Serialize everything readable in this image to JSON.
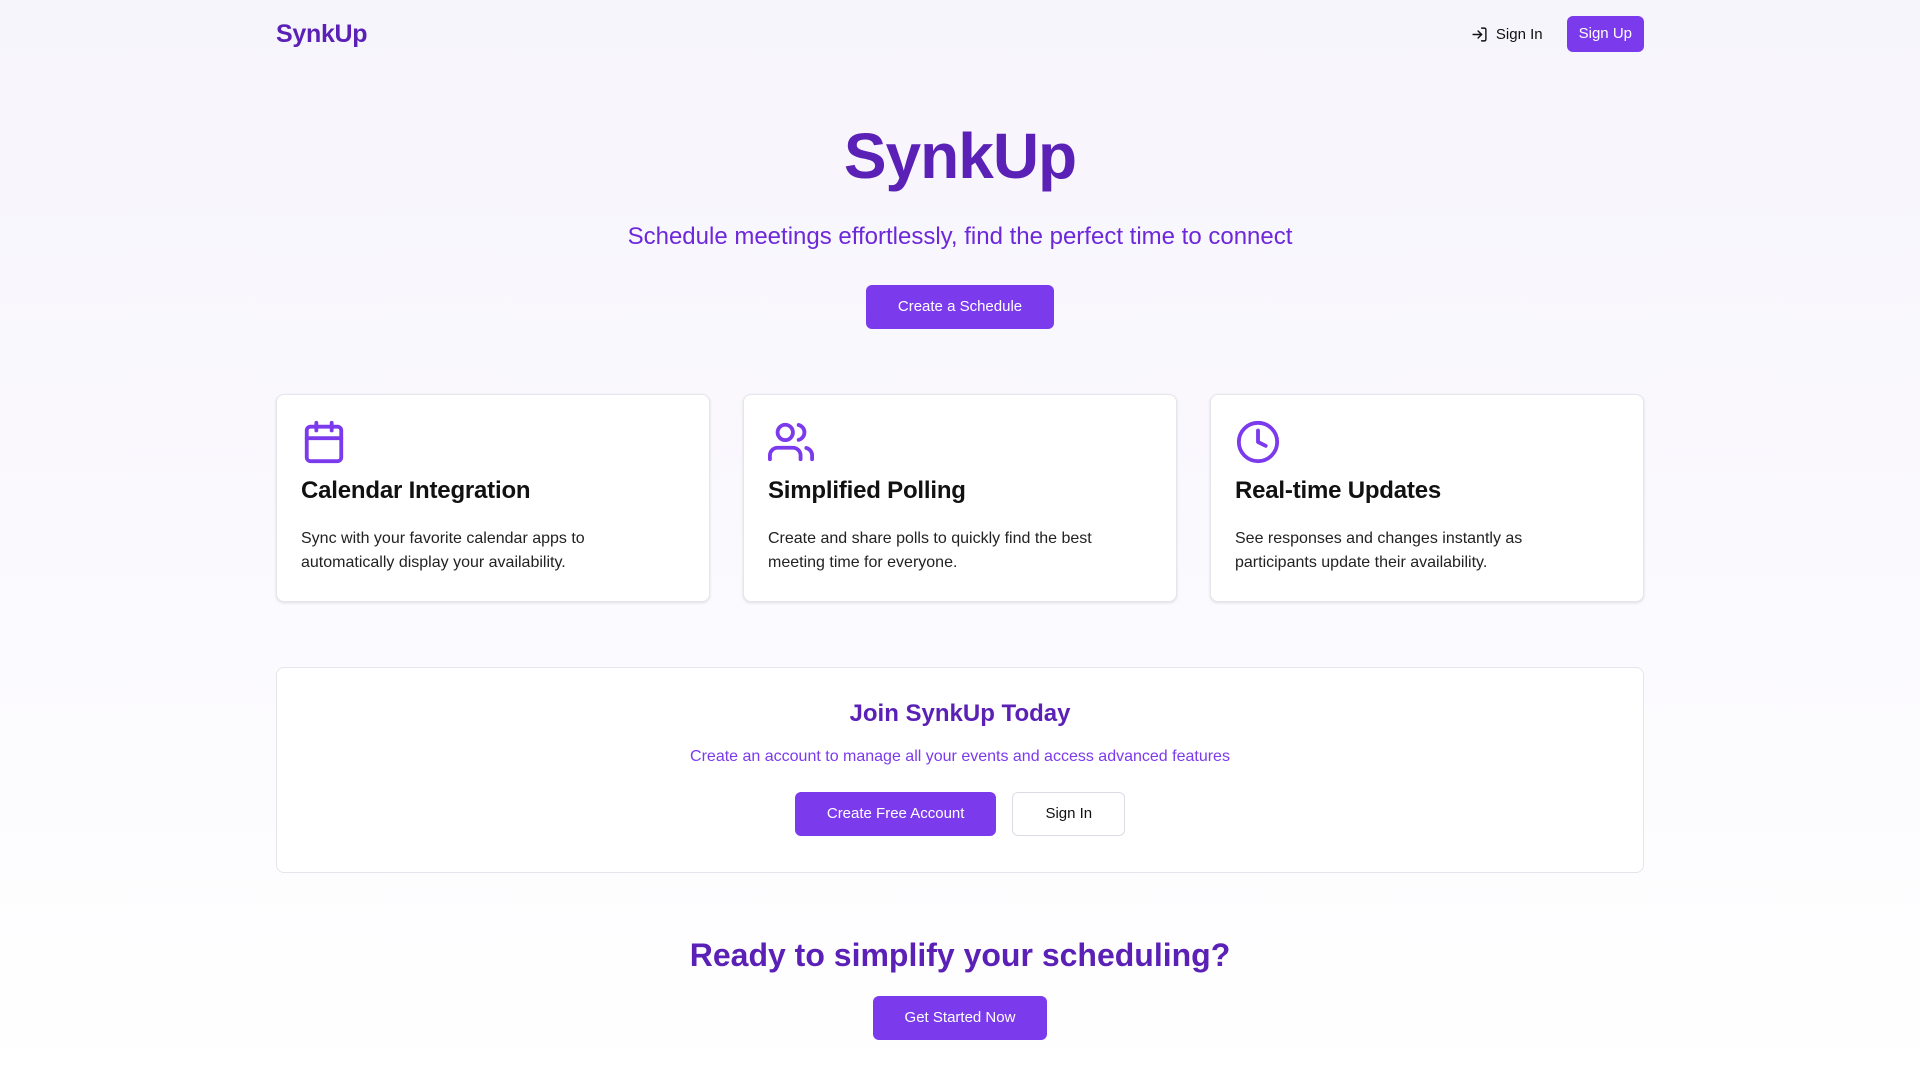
{
  "header": {
    "brand": "SynkUp",
    "sign_in_label": "Sign In",
    "sign_up_label": "Sign Up"
  },
  "hero": {
    "title": "SynkUp",
    "subtitle": "Schedule meetings effortlessly, find the perfect time to connect",
    "cta_label": "Create a Schedule"
  },
  "features": [
    {
      "icon": "calendar-icon",
      "title": "Calendar Integration",
      "description": "Sync with your favorite calendar apps to automatically display your availability."
    },
    {
      "icon": "users-icon",
      "title": "Simplified Polling",
      "description": "Create and share polls to quickly find the best meeting time for everyone."
    },
    {
      "icon": "clock-icon",
      "title": "Real-time Updates",
      "description": "See responses and changes instantly as participants update their availability."
    }
  ],
  "join": {
    "title": "Join SynkUp Today",
    "subtitle": "Create an account to manage all your events and access advanced features",
    "primary_label": "Create Free Account",
    "secondary_label": "Sign In"
  },
  "cta": {
    "title": "Ready to simplify your scheduling?",
    "button_label": "Get Started Now"
  },
  "colors": {
    "brand": "#5b21b6",
    "accent": "#7c3aed",
    "text": "#111111"
  }
}
